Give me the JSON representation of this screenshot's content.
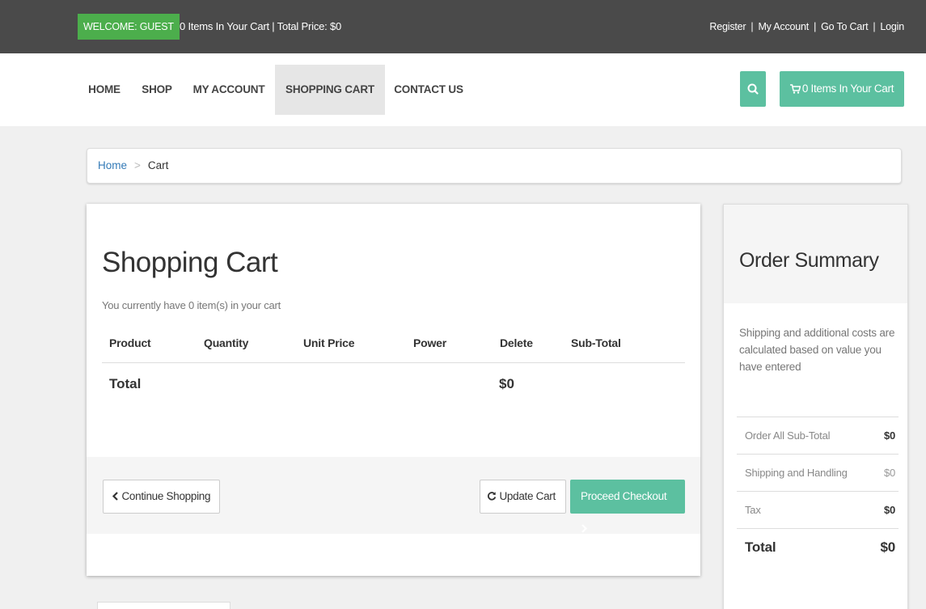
{
  "topbar": {
    "welcome": "WELCOME: GUEST",
    "cart_info": "0 Items In Your Cart | Total Price: $0",
    "links": [
      "Register",
      "My Account",
      "Go To Cart",
      "Login"
    ],
    "separator": "|"
  },
  "nav": {
    "items": [
      "HOME",
      "SHOP",
      "MY ACCOUNT",
      "SHOPPING CART",
      "CONTACT US"
    ],
    "active": "SHOPPING CART",
    "search_icon": "search-icon",
    "cart_button": "0 Items In Your Cart",
    "cart_icon": "shopping-cart-icon"
  },
  "breadcrumb": {
    "home": "Home",
    "separator": ">",
    "current": "Cart"
  },
  "cart": {
    "title": "Shopping Cart",
    "subtitle": "You currently have 0 item(s) in your cart",
    "columns": [
      "Product",
      "Quantity",
      "Unit Price",
      "Power",
      "Delete",
      "Sub-Total"
    ],
    "total_label": "Total",
    "total_value": "$0",
    "continue_label": "Continue Shopping",
    "update_label": "Update Cart",
    "checkout_label": "Proceed Checkout"
  },
  "summary": {
    "title": "Order Summary",
    "description": "Shipping and additional costs are calculated based on value you have entered",
    "rows": [
      {
        "label": "Order All Sub-Total",
        "value": "$0"
      },
      {
        "label": "Shipping and Handling",
        "value": "$0"
      },
      {
        "label": "Tax",
        "value": "$0"
      }
    ],
    "total_label": "Total",
    "total_value": "$0"
  },
  "colors": {
    "topbar_bg": "#4a4a4a",
    "welcome_bg": "#4cae4c",
    "accent": "#5cc0a0",
    "link": "#337ab7"
  }
}
